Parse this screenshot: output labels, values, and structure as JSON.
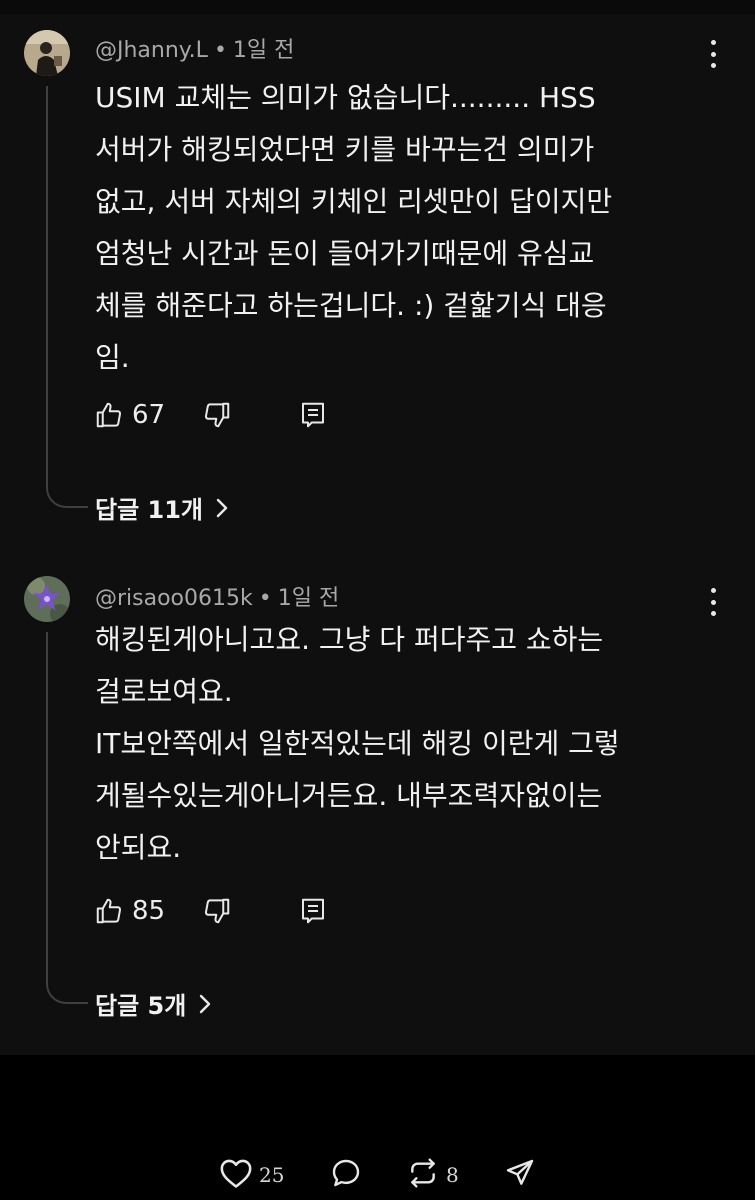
{
  "comments": [
    {
      "handle": "@Jhanny.L",
      "time": "1일 전",
      "lines": [
        "USIM 교체는 의미가 없습니다......... HSS",
        "서버가 해킹되었다면 키를 바꾸는건 의미가",
        "없고, 서버 자체의 키체인 리셋만이 답이지만",
        "엄청난 시간과 돈이 들어가기때문에 유심교",
        "체를 해준다고 하는겁니다. :) 겉핥기식 대응",
        "임."
      ],
      "likes": "67",
      "replies_label": "답글 11개"
    },
    {
      "handle": "@risaoo0615k",
      "time": "1일 전",
      "lines": [
        "해킹된게아니고요. 그냥 다 퍼다주고 쇼하는",
        "걸로보여요.",
        "IT보안쪽에서 일한적있는데 해킹 이란게 그렇",
        "게될수있는게아니거든요. 내부조력자없이는",
        "안되요."
      ],
      "likes": "85",
      "replies_label": "답글 5개"
    }
  ],
  "bottom_bar": {
    "likes": "25",
    "reposts": "8",
    "icons": [
      "heart-icon",
      "comment-bubble-icon",
      "repost-icon",
      "share-icon"
    ]
  },
  "colors": {
    "background": "#0f0f0f",
    "text": "#f1f1f1",
    "meta": "#a8a8a8",
    "thread_line": "#3f3f3f"
  }
}
